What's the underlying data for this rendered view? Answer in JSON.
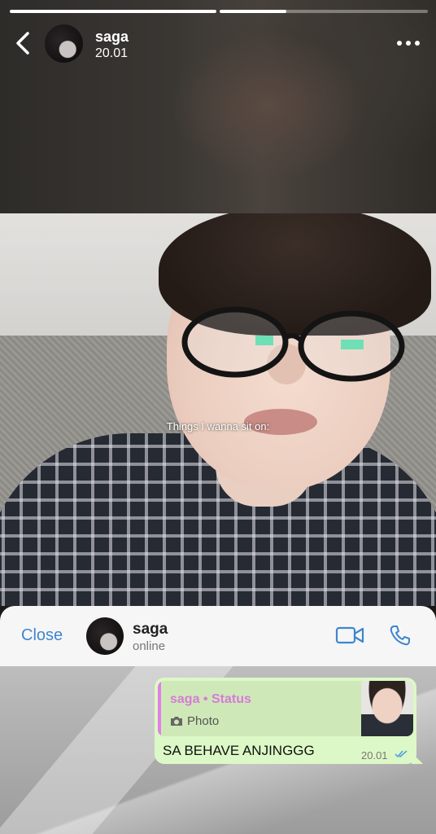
{
  "story": {
    "progress": [
      1.0,
      0.32
    ],
    "name": "saga",
    "time": "20.01",
    "caption": "Things I wanna sit on:"
  },
  "icons": {
    "back": "chevron-left-icon",
    "more": "more-horizontal-icon",
    "video": "video-call-icon",
    "phone": "phone-icon",
    "camera": "camera-icon",
    "ticks": "double-check-icon"
  },
  "chat": {
    "close_label": "Close",
    "name": "saga",
    "status": "online"
  },
  "message": {
    "quote_author": "saga • Status",
    "quote_type": "Photo",
    "text": "SA BEHAVE ANJINGGG",
    "time": "20.01"
  },
  "colors": {
    "accent": "#3f86cf",
    "bubble": "#dcf8c6",
    "quote_accent": "#e27ee5"
  }
}
